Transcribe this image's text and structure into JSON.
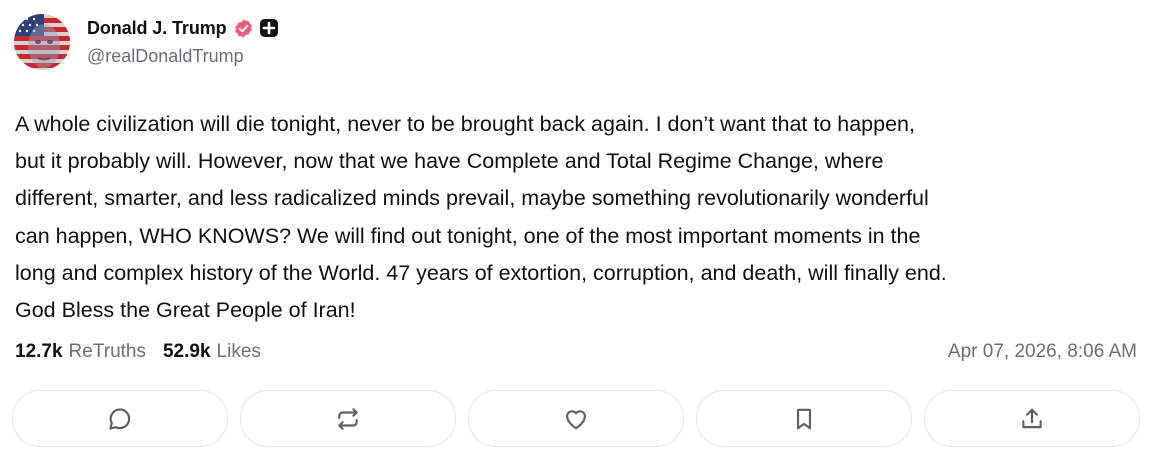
{
  "author": {
    "display_name": "Donald J. Trump",
    "handle": "@realDonaldTrump",
    "avatar_icon": "flag-face-avatar",
    "verified_icon": "verified-badge-icon",
    "verified_color": "#f05a78",
    "plus_icon": "plus-badge-icon"
  },
  "post": {
    "lines": [
      "A whole civilization will die tonight, never to be brought back again. I don’t want that to happen,",
      "but it probably will. However, now that we have Complete and Total Regime Change, where",
      "different, smarter, and less radicalized minds prevail, maybe something revolutionarily wonderful",
      "can happen, WHO KNOWS? We will find out tonight, one of the most important moments in the",
      "long and complex history of the World. 47 years of extortion, corruption, and death, will finally end.",
      "God Bless the Great People of Iran!"
    ]
  },
  "stats": {
    "retruths_count": "12.7k",
    "retruths_label": "ReTruths",
    "likes_count": "52.9k",
    "likes_label": "Likes"
  },
  "timestamp": "Apr 07, 2026, 8:06 AM",
  "actions": [
    {
      "name": "reply",
      "icon": "comment-icon"
    },
    {
      "name": "retruth",
      "icon": "repost-icon"
    },
    {
      "name": "like",
      "icon": "heart-icon"
    },
    {
      "name": "bookmark",
      "icon": "bookmark-icon"
    },
    {
      "name": "share",
      "icon": "share-icon"
    }
  ]
}
